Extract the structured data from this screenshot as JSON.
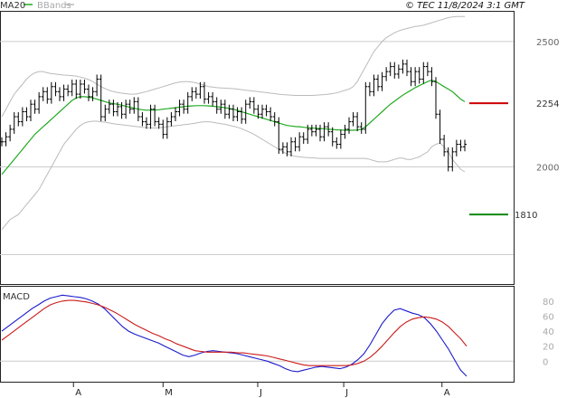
{
  "header": {
    "ma_label": "MA20",
    "bb_label": "BBands",
    "source_label": "© TEC 11/8/2024 3:1 GMT"
  },
  "colors": {
    "price": "#000000",
    "ma": "#22aa22",
    "bands": "#bbbbbb",
    "macd": "#1a1acc",
    "signal": "#cc1a1a",
    "resistance": "#cc0000",
    "support": "#118811"
  },
  "chart_data": [
    {
      "type": "candlestick",
      "x_labels": [
        "A",
        "M",
        "J",
        "J",
        "A"
      ],
      "y_ticks": [
        2500,
        2000
      ],
      "ylim": [
        1540,
        2615
      ],
      "levels": [
        {
          "value": 2254,
          "label": "2254",
          "kind": "resistance"
        },
        {
          "value": 1810,
          "label": "1810",
          "kind": "support"
        }
      ],
      "series": {
        "close": [
          2100,
          2120,
          2150,
          2200,
          2180,
          2220,
          2200,
          2250,
          2230,
          2280,
          2300,
          2270,
          2320,
          2300,
          2280,
          2310,
          2300,
          2330,
          2290,
          2330,
          2310,
          2280,
          2300,
          2350,
          2200,
          2230,
          2250,
          2220,
          2240,
          2210,
          2250,
          2230,
          2260,
          2200,
          2180,
          2170,
          2230,
          2180,
          2170,
          2130,
          2180,
          2200,
          2220,
          2250,
          2230,
          2280,
          2300,
          2290,
          2320,
          2270,
          2280,
          2260,
          2230,
          2250,
          2210,
          2230,
          2200,
          2220,
          2190,
          2250,
          2260,
          2230,
          2210,
          2230,
          2220,
          2200,
          2180,
          2070,
          2080,
          2060,
          2100,
          2080,
          2120,
          2110,
          2150,
          2140,
          2150,
          2120,
          2160,
          2140,
          2100,
          2090,
          2130,
          2150,
          2180,
          2200,
          2160,
          2150,
          2320,
          2300,
          2350,
          2320,
          2360,
          2380,
          2400,
          2370,
          2390,
          2410,
          2380,
          2340,
          2380,
          2350,
          2400,
          2380,
          2340,
          2210,
          2110,
          2060,
          2000,
          2060,
          2090,
          2080,
          2090
        ],
        "ma20": [
          1970,
          1990,
          2010,
          2030,
          2050,
          2070,
          2090,
          2110,
          2130,
          2145,
          2160,
          2175,
          2190,
          2205,
          2220,
          2235,
          2250,
          2265,
          2275,
          2280,
          2280,
          2278,
          2275,
          2270,
          2265,
          2260,
          2255,
          2252,
          2250,
          2246,
          2242,
          2238,
          2234,
          2230,
          2228,
          2226,
          2226,
          2227,
          2228,
          2230,
          2232,
          2234,
          2236,
          2238,
          2240,
          2242,
          2243,
          2244,
          2244,
          2244,
          2243,
          2242,
          2240,
          2238,
          2236,
          2233,
          2230,
          2225,
          2220,
          2215,
          2210,
          2205,
          2200,
          2195,
          2190,
          2185,
          2180,
          2175,
          2170,
          2165,
          2163,
          2161,
          2160,
          2158,
          2156,
          2155,
          2154,
          2153,
          2152,
          2150,
          2149,
          2148,
          2147,
          2146,
          2146,
          2146,
          2147,
          2150,
          2160,
          2175,
          2190,
          2205,
          2220,
          2235,
          2250,
          2262,
          2274,
          2286,
          2296,
          2306,
          2316,
          2324,
          2332,
          2340,
          2346,
          2340,
          2330,
          2320,
          2310,
          2300,
          2285,
          2270,
          2260
        ],
        "bb_upper": [
          2200,
          2230,
          2260,
          2290,
          2310,
          2330,
          2350,
          2365,
          2375,
          2380,
          2380,
          2375,
          2372,
          2370,
          2368,
          2366,
          2365,
          2364,
          2362,
          2358,
          2354,
          2348,
          2340,
          2330,
          2320,
          2312,
          2305,
          2300,
          2297,
          2294,
          2292,
          2290,
          2290,
          2292,
          2296,
          2300,
          2305,
          2310,
          2315,
          2320,
          2325,
          2330,
          2335,
          2338,
          2340,
          2340,
          2338,
          2335,
          2330,
          2325,
          2320,
          2318,
          2316,
          2315,
          2314,
          2313,
          2312,
          2310,
          2308,
          2306,
          2304,
          2302,
          2300,
          2298,
          2296,
          2294,
          2292,
          2290,
          2288,
          2287,
          2286,
          2285,
          2285,
          2285,
          2285,
          2285,
          2286,
          2287,
          2288,
          2290,
          2292,
          2295,
          2300,
          2305,
          2310,
          2320,
          2340,
          2370,
          2400,
          2430,
          2460,
          2480,
          2500,
          2515,
          2525,
          2535,
          2542,
          2548,
          2552,
          2556,
          2560,
          2562,
          2565,
          2570,
          2575,
          2580,
          2585,
          2590,
          2595,
          2598,
          2600,
          2600,
          2600
        ],
        "bb_lower": [
          1750,
          1770,
          1790,
          1800,
          1810,
          1830,
          1850,
          1870,
          1890,
          1910,
          1940,
          1970,
          2000,
          2030,
          2060,
          2090,
          2110,
          2130,
          2150,
          2165,
          2175,
          2180,
          2182,
          2182,
          2180,
          2178,
          2175,
          2172,
          2170,
          2168,
          2166,
          2164,
          2162,
          2160,
          2158,
          2156,
          2155,
          2155,
          2156,
          2158,
          2160,
          2162,
          2164,
          2166,
          2168,
          2170,
          2172,
          2175,
          2178,
          2180,
          2180,
          2178,
          2175,
          2172,
          2170,
          2166,
          2162,
          2158,
          2152,
          2145,
          2138,
          2130,
          2120,
          2110,
          2100,
          2090,
          2080,
          2070,
          2060,
          2052,
          2046,
          2042,
          2040,
          2038,
          2037,
          2036,
          2035,
          2034,
          2034,
          2034,
          2034,
          2034,
          2034,
          2034,
          2034,
          2034,
          2034,
          2034,
          2034,
          2030,
          2025,
          2020,
          2020,
          2020,
          2025,
          2030,
          2035,
          2035,
          2030,
          2030,
          2035,
          2040,
          2050,
          2060,
          2080,
          2090,
          2095,
          2080,
          2060,
          2030,
          2010,
          1990,
          1980
        ]
      }
    },
    {
      "type": "line",
      "title": "MACD",
      "y_ticks": [
        80,
        60,
        40,
        20,
        0
      ],
      "ylim": [
        -25,
        98
      ],
      "series": [
        {
          "values": [
            40,
            46,
            52,
            58,
            64,
            70,
            75,
            80,
            84,
            86,
            88,
            87,
            86,
            85,
            83,
            80,
            76,
            70,
            62,
            54,
            46,
            40,
            36,
            33,
            30,
            27,
            24,
            20,
            16,
            12,
            8,
            6,
            8,
            11,
            13,
            14,
            13,
            12,
            11,
            10,
            8,
            6,
            4,
            2,
            0,
            -3,
            -6,
            -10,
            -13,
            -14,
            -12,
            -10,
            -8,
            -7,
            -8,
            -9,
            -10,
            -8,
            -4,
            2,
            10,
            22,
            36,
            50,
            60,
            68,
            70,
            67,
            64,
            62,
            58,
            50,
            40,
            28,
            16,
            2,
            -12,
            -20
          ],
          "color": "macd"
        },
        {
          "values": [
            28,
            34,
            40,
            46,
            52,
            58,
            64,
            70,
            75,
            78,
            80,
            81,
            81,
            80,
            79,
            77,
            75,
            72,
            68,
            64,
            59,
            54,
            49,
            45,
            41,
            37,
            34,
            30,
            27,
            23,
            20,
            17,
            14,
            13,
            12,
            12,
            12,
            12,
            12,
            11,
            11,
            10,
            9,
            8,
            7,
            5,
            3,
            1,
            -1,
            -3,
            -5,
            -6,
            -6,
            -6,
            -6,
            -6,
            -6,
            -6,
            -5,
            -3,
            0,
            5,
            12,
            20,
            29,
            38,
            46,
            52,
            56,
            58,
            59,
            58,
            56,
            52,
            46,
            38,
            30,
            20
          ],
          "color": "signal"
        }
      ]
    }
  ]
}
